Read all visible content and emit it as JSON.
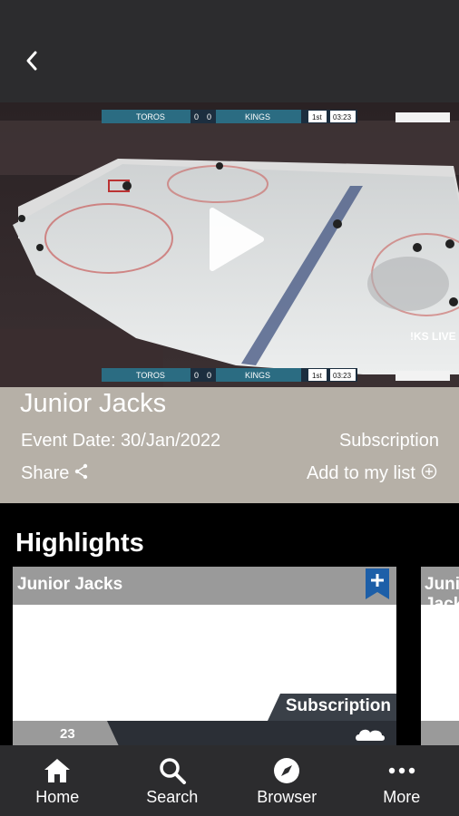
{
  "colors": {
    "top_bar": "#2c2c2e",
    "info_panel": "#b6b0a7",
    "card_header": "#9a9a9a",
    "bookmark": "#1d5fa8",
    "card_footer": "#2b2f36"
  },
  "header": {
    "back_icon": "chevron-left-icon"
  },
  "video": {
    "play_icon": "play-icon",
    "scoreboard": {
      "home_team": "TOROS",
      "home_score": "0",
      "away_score": "0",
      "away_team": "KINGS",
      "period": "1st",
      "clock": "03:23"
    },
    "watermark": "!KS LIVE"
  },
  "event": {
    "title": "Junior Jacks",
    "date": "Event Date: 30/Jan/2022",
    "access": "Subscription",
    "share_label": "Share",
    "add_label": "Add to my list"
  },
  "highlights": {
    "heading": "Highlights",
    "cards": [
      {
        "title": "Junior Jacks",
        "tag": "Subscription",
        "count": "23"
      },
      {
        "title": "Junior Jacks"
      }
    ]
  },
  "nav": {
    "items": [
      {
        "label": "Home",
        "icon": "home-icon"
      },
      {
        "label": "Search",
        "icon": "search-icon"
      },
      {
        "label": "Browser",
        "icon": "compass-icon"
      },
      {
        "label": "More",
        "icon": "more-icon"
      }
    ]
  }
}
